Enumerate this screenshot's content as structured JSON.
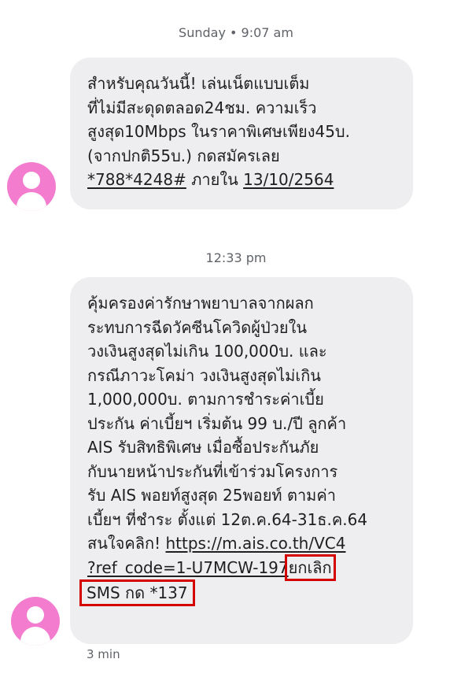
{
  "conversation": {
    "timestamps": [
      "Sunday • 9:07 am",
      "12:33 pm"
    ],
    "messages": [
      {
        "lines": [
          "สำหรับคุณวันนี้! เล่นเน็ตแบบเต็ม",
          "ที่ไม่มีสะดุดตลอด24ชม. ความเร็ว",
          "สูงสุด10Mbps ในราคาพิเศษเพียง45บ.",
          "(จากปกติ55บ.) กดสมัครเลย"
        ],
        "ussd_code": "*788*4248#",
        "within_text": "ภายใน",
        "expiry_date": "13/10/2564"
      },
      {
        "lines": [
          "คุ้มครองค่ารักษาพยาบาลจากผลก",
          "ระทบการฉีดวัคซีนโควิดผู้ป่วยใน",
          "วงเงินสูงสุดไม่เกิน 100,000บ. และ",
          "กรณีภาวะโคม่า วงเงินสูงสุดไม่เกิน",
          "1,000,000บ. ตามการชำระค่าเบี้ย",
          "ประกัน ค่าเบี้ยฯ เริ่มต้น 99 บ./ปี ลูกค้า",
          "AIS รับสิทธิพิเศษ เมื่อซื้อประกันภัย",
          "กับนายหน้าประกันที่เข้าร่วมโครงการ",
          "รับ AIS พอยท์สูงสุด 25พอยท์ ตามค่า",
          "เบี้ยฯ ที่ชำระ ตั้งแต่ 12ต.ค.64-31ธ.ค.64"
        ],
        "link_prefix": "สนใจคลิก!",
        "link_part1": "https://m.ais.co.th/VC4",
        "link_part2": "?ref_code=1-U7MCW-197",
        "cancel_text": "ยกเลิก",
        "sms_cancel": "SMS กด *137",
        "time_ago": "3 min"
      }
    ]
  },
  "colors": {
    "avatar": "#f37ccf",
    "bubble": "#eeeef1",
    "highlight_box": "#d40000"
  }
}
